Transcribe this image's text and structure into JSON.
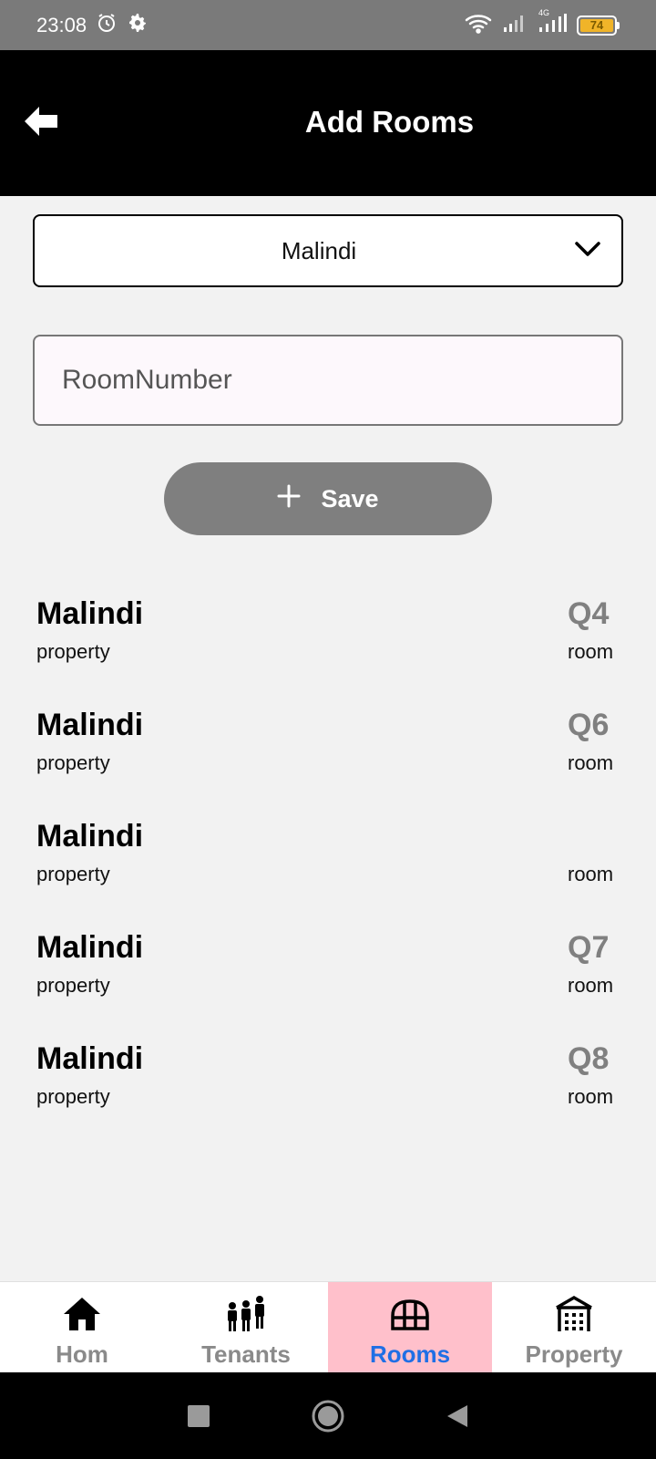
{
  "status_bar": {
    "time": "23:08",
    "network_label": "4G",
    "battery_level": "74"
  },
  "header": {
    "title": "Add Rooms"
  },
  "form": {
    "selected_property": "Malindi",
    "room_number_placeholder": "RoomNumber",
    "room_number_value": "",
    "save_label": "Save"
  },
  "rooms": [
    {
      "property": "Malindi",
      "property_label": "property",
      "room": "Q4",
      "room_label": "room"
    },
    {
      "property": "Malindi",
      "property_label": "property",
      "room": "Q6",
      "room_label": "room"
    },
    {
      "property": "Malindi",
      "property_label": "property",
      "room": "",
      "room_label": "room"
    },
    {
      "property": "Malindi",
      "property_label": "property",
      "room": "Q7",
      "room_label": "room"
    },
    {
      "property": "Malindi",
      "property_label": "property",
      "room": "Q8",
      "room_label": "room"
    }
  ],
  "bottom_nav": {
    "items": [
      {
        "label": "Hom",
        "icon": "home-icon"
      },
      {
        "label": "Tenants",
        "icon": "people-icon"
      },
      {
        "label": "Rooms",
        "icon": "room-icon",
        "active": true
      },
      {
        "label": "Property",
        "icon": "building-icon"
      }
    ]
  },
  "colors": {
    "app_bar": "#000000",
    "save_button": "#7f7f7f",
    "active_tab_bg": "#ffc0cb",
    "active_tab_text": "#1f6fe5",
    "inactive_tab_text": "#8a8a8a",
    "room_number_text": "#808080"
  }
}
